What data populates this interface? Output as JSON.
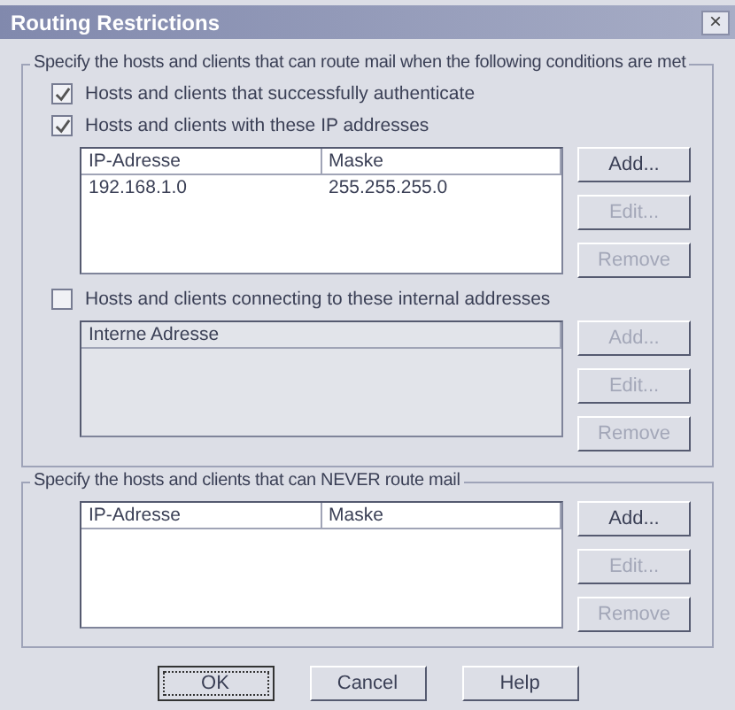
{
  "window": {
    "title": "Routing Restrictions",
    "close": "×"
  },
  "groups": [
    {
      "legend": "Specify the hosts and clients that can route mail when the following conditions are met",
      "items": [
        {
          "kind": "checkbox",
          "label": "Hosts and clients that successfully authenticate",
          "checked": true
        },
        {
          "kind": "checkbox",
          "label": "Hosts and clients with these IP addresses",
          "checked": true
        },
        {
          "kind": "list",
          "disabled": false,
          "columns": [
            "IP-Adresse",
            "Maske"
          ],
          "rows": [
            [
              "192.168.1.0",
              "255.255.255.0"
            ]
          ],
          "buttons": [
            {
              "label": "Add...",
              "disabled": false
            },
            {
              "label": "Edit...",
              "disabled": true
            },
            {
              "label": "Remove",
              "disabled": true
            }
          ]
        },
        {
          "kind": "checkbox",
          "label": "Hosts and clients connecting to these internal addresses",
          "checked": false
        },
        {
          "kind": "list",
          "disabled": true,
          "columns": [
            "Interne Adresse"
          ],
          "buttons": [
            {
              "label": "Add...",
              "disabled": true
            },
            {
              "label": "Edit...",
              "disabled": true
            },
            {
              "label": "Remove",
              "disabled": true
            }
          ]
        }
      ]
    },
    {
      "legend": "Specify the hosts and clients that can NEVER route mail",
      "items": [
        {
          "kind": "list",
          "disabled": false,
          "columns": [
            "IP-Adresse",
            "Maske"
          ],
          "buttons": [
            {
              "label": "Add...",
              "disabled": false
            },
            {
              "label": "Edit...",
              "disabled": true
            },
            {
              "label": "Remove",
              "disabled": true
            }
          ]
        }
      ]
    }
  ],
  "buttons": [
    {
      "label": "OK",
      "default": true
    },
    {
      "label": "Cancel",
      "default": false
    },
    {
      "label": "Help",
      "default": false
    }
  ]
}
